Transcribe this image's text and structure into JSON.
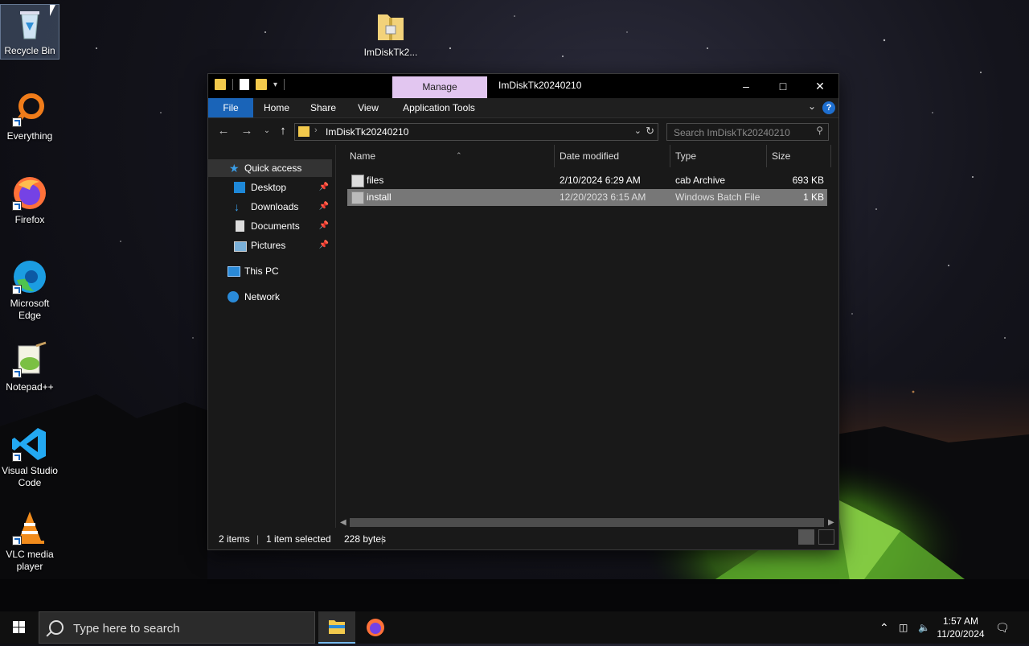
{
  "desktop": {
    "icons": [
      {
        "label": "Recycle Bin",
        "icon": "recycle-bin-icon"
      },
      {
        "label": "Everything",
        "icon": "everything-icon"
      },
      {
        "label": "Firefox",
        "icon": "firefox-icon"
      },
      {
        "label": "Microsoft Edge",
        "icon": "edge-icon"
      },
      {
        "label": "Notepad++",
        "icon": "notepadpp-icon"
      },
      {
        "label": "Visual Studio Code",
        "icon": "vscode-icon"
      },
      {
        "label": "VLC media player",
        "icon": "vlc-icon"
      },
      {
        "label": "ImDiskTk2...",
        "icon": "zip-folder-icon"
      }
    ]
  },
  "explorer": {
    "title": "ImDiskTk20240210",
    "manage_tab": "Manage",
    "ribbon_tabs": [
      "File",
      "Home",
      "Share",
      "View",
      "Application Tools"
    ],
    "address_path": "ImDiskTk20240210",
    "search_placeholder": "Search ImDiskTk20240210",
    "nav": {
      "quick_access": "Quick access",
      "desktop": "Desktop",
      "downloads": "Downloads",
      "documents": "Documents",
      "pictures": "Pictures",
      "this_pc": "This PC",
      "network": "Network"
    },
    "columns": [
      "Name",
      "Date modified",
      "Type",
      "Size"
    ],
    "files": [
      {
        "name": "files",
        "date": "2/10/2024 6:29 AM",
        "type": "cab Archive",
        "size": "693 KB"
      },
      {
        "name": "install",
        "date": "12/20/2023 6:15 AM",
        "type": "Windows Batch File",
        "size": "1 KB"
      }
    ],
    "status": {
      "items": "2 items",
      "selected": "1 item selected",
      "bytes": "228 bytes"
    }
  },
  "taskbar": {
    "search_placeholder": "Type here to search",
    "time": "1:57 AM",
    "date": "11/20/2024"
  },
  "colors": {
    "accent": "#1a64b8",
    "manage_tab": "#e2c6f0",
    "folder": "#f2c94c"
  }
}
